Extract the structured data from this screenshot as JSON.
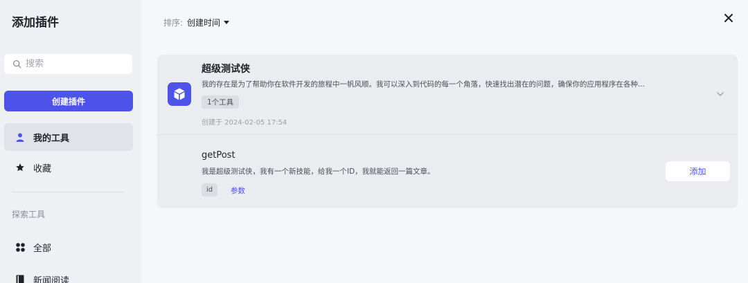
{
  "sidebar": {
    "title": "添加插件",
    "search_placeholder": "搜索",
    "create_label": "创建插件",
    "items": [
      {
        "label": "我的工具",
        "icon": "user-icon"
      },
      {
        "label": "收藏",
        "icon": "star-icon"
      }
    ],
    "section_label": "探索工具",
    "explore_items": [
      {
        "label": "全部",
        "icon": "grid-icon"
      },
      {
        "label": "新闻阅读",
        "icon": "book-icon"
      }
    ]
  },
  "toolbar": {
    "sort_key": "排序:",
    "sort_value": "创建时间"
  },
  "plugin": {
    "name": "超级测试侠",
    "description": "我的存在是为了帮助你在软件开发的旅程中一帆风顺。我可以深入到代码的每一个角落，快速找出潜在的问题，确保你的应用程序在各种...",
    "tool_count": "1个工具",
    "created": "创建于 2024-02-05 17:54",
    "accent_color": "#4d53e8"
  },
  "tool": {
    "name": "getPost",
    "description": "我是超级测试侠，我有一个新技能，给我一个ID，我就能返回一篇文章。",
    "param": "id",
    "param_link": "参数",
    "add_label": "添加"
  }
}
